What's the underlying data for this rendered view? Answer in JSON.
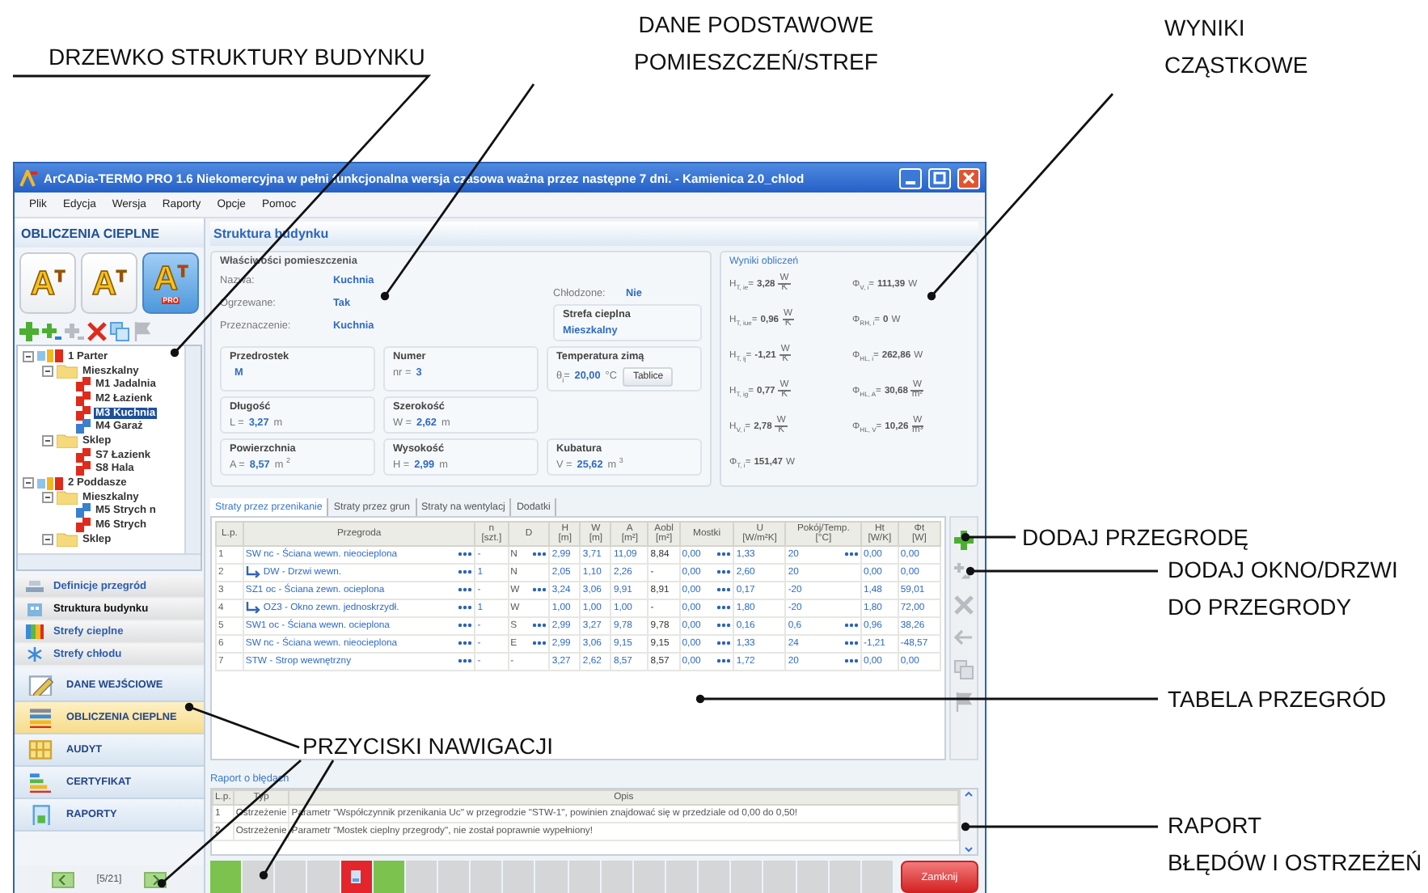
{
  "window": {
    "title": "ArCADia-TERMO PRO 1.6 Niekomercyjna w pełni funkcjonalna wersja czasowa ważna przez następne 7 dni. - Kamienica 2.0_chlod"
  },
  "menu": [
    "Plik",
    "Edycja",
    "Wersja",
    "Raporty",
    "Opcje",
    "Pomoc"
  ],
  "sidebar": {
    "title": "OBLICZENIA CIEPLNE",
    "modes": [
      {
        "letter": "A",
        "superscript": "T",
        "selected": false
      },
      {
        "letter": "A",
        "superscript": "T",
        "selected": false
      },
      {
        "letter": "A",
        "superscript": "T",
        "badge": "PRO",
        "selected": true
      }
    ],
    "tools": [
      {
        "kind": "add",
        "disabled": false
      },
      {
        "kind": "add-small",
        "disabled": false
      },
      {
        "kind": "add-small",
        "disabled": true
      },
      {
        "kind": "delete",
        "disabled": false
      },
      {
        "kind": "copy",
        "disabled": false
      },
      {
        "kind": "flag",
        "disabled": true
      }
    ],
    "tree": [
      {
        "label": "1 Parter",
        "kind": "floor",
        "expanded": true,
        "selected": false,
        "children": [
          {
            "label": "Mieszkalny",
            "kind": "zone",
            "expanded": true,
            "selected": false,
            "children": [
              {
                "label": "M1 Jadalnia",
                "kind": "room",
                "color": "#e02a1c",
                "selected": false
              },
              {
                "label": "M2 Łazienk",
                "kind": "room",
                "color": "#e02a1c",
                "selected": false
              },
              {
                "label": "M3 Kuchnia",
                "kind": "room",
                "color": "#e02a1c",
                "selected": true
              },
              {
                "label": "M4 Garaż",
                "kind": "room",
                "color": "#3a7fd0",
                "selected": false
              }
            ]
          },
          {
            "label": "Sklep",
            "kind": "zone",
            "expanded": true,
            "selected": false,
            "children": [
              {
                "label": "S7 Łazienk",
                "kind": "room",
                "color": "#e02a1c",
                "selected": false
              },
              {
                "label": "S8 Hala",
                "kind": "room",
                "color": "#e02a1c",
                "selected": false
              }
            ]
          }
        ]
      },
      {
        "label": "2 Poddasze",
        "kind": "floor",
        "expanded": true,
        "selected": false,
        "children": [
          {
            "label": "Mieszkalny",
            "kind": "zone",
            "expanded": true,
            "selected": false,
            "children": [
              {
                "label": "M5 Strych n",
                "kind": "room",
                "color": "#3a7fd0",
                "selected": false
              },
              {
                "label": "M6 Strych",
                "kind": "room",
                "color": "#e02a1c",
                "selected": false
              }
            ]
          },
          {
            "label": "Sklep",
            "kind": "zone",
            "expanded": true,
            "selected": false
          }
        ]
      }
    ],
    "sections": [
      {
        "label": "Definicje przegród",
        "kind": "definitions",
        "selected": false
      },
      {
        "label": "Struktura budynku",
        "kind": "structure",
        "selected": true
      },
      {
        "label": "Strefy cieplne",
        "kind": "heat",
        "selected": false
      },
      {
        "label": "Strefy chłodu",
        "kind": "cold",
        "selected": false
      }
    ],
    "nav": [
      {
        "label": "DANE WEJŚCIOWE",
        "kind": "input",
        "selected": false
      },
      {
        "label": "OBLICZENIA CIEPLNE",
        "kind": "calc",
        "selected": true
      },
      {
        "label": "AUDYT",
        "kind": "audit",
        "selected": false
      },
      {
        "label": "CERTYFIKAT",
        "kind": "certificate",
        "selected": false
      },
      {
        "label": "RAPORTY",
        "kind": "report",
        "selected": false
      }
    ],
    "pager": {
      "position": "[5/21]"
    }
  },
  "content": {
    "title": "Struktura budynku",
    "properties": {
      "title": "Właściwości pomieszczenia",
      "fields": [
        {
          "label": "Nazwa:",
          "value": "Kuchnia"
        },
        {
          "label": "Ogrzewane:",
          "value": "Tak"
        },
        {
          "label": "Przeznaczenie:",
          "value": "Kuchnia"
        }
      ],
      "cooling": {
        "label": "Chłodzone:",
        "value": "Nie"
      },
      "zone": {
        "title": "Strefa cieplna",
        "value": "Mieszkalny"
      },
      "group_rows": [
        [
          {
            "title": "Przedrostek",
            "value": "M"
          },
          {
            "title": "Numer",
            "symbol": "nr =",
            "value": "3"
          },
          {
            "title": "Temperatura zimą",
            "symbol": "θ$_{i}$=",
            "value": "20,00",
            "unit": "°C",
            "button": "Tablice"
          }
        ],
        [
          {
            "title": "Długość",
            "symbol": "L =",
            "value": "3,27",
            "unit": "m"
          },
          {
            "title": "Szerokość",
            "symbol": "W =",
            "value": "2,62",
            "unit": "m"
          }
        ],
        [
          {
            "title": "Powierzchnia",
            "symbol": "A =",
            "value": "8,57",
            "unit": "m $^{2}$"
          },
          {
            "title": "Wysokość",
            "symbol": "H =",
            "value": "2,99",
            "unit": "m"
          },
          {
            "title": "Kubatura",
            "symbol": "V =",
            "value": "25,62",
            "unit": "m $^{3}$"
          }
        ]
      ]
    },
    "results": {
      "title": "Wyniki obliczeń",
      "items": [
        {
          "symbol": "H$_{T, ie}$=",
          "value": "3,28",
          "unit": "W",
          "per": "K"
        },
        {
          "symbol": "Φ$_{V, i}$=",
          "value": "111,39",
          "unit": "W"
        },
        {
          "symbol": "H$_{T, iue}$=",
          "value": "0,96",
          "unit": "W",
          "per": "K"
        },
        {
          "symbol": "Φ$_{RH, i}$=",
          "value": "0",
          "unit": "W"
        },
        {
          "symbol": "H$_{T, ij}$=",
          "value": "-1,21",
          "unit": "W",
          "per": "K"
        },
        {
          "symbol": "Φ$_{HL, i}$=",
          "value": "262,86",
          "unit": "W"
        },
        {
          "symbol": "H$_{T, ig}$=",
          "value": "0,77",
          "unit": "W",
          "per": "K"
        },
        {
          "symbol": "Φ$_{HL, A}$=",
          "value": "30,68",
          "unit": "W",
          "per": "m²"
        },
        {
          "symbol": "H$_{V, i}$=",
          "value": "2,78",
          "unit": "W",
          "per": "K"
        },
        {
          "symbol": "Φ$_{HL, V}$=",
          "value": "10,26",
          "unit": "W",
          "per": "m³"
        },
        {
          "symbol": "Φ$_{T, i}$=",
          "value": "151,47",
          "unit": "W"
        }
      ]
    },
    "tabs": [
      {
        "label": "Straty przez przenikanie",
        "selected": true
      },
      {
        "label": "Straty przez grun",
        "selected": false
      },
      {
        "label": "Straty na wentylacj",
        "selected": false
      },
      {
        "label": "Dodatki",
        "selected": false
      }
    ],
    "table": {
      "columns": [
        {
          "name": "L.p."
        },
        {
          "name": "Przegroda"
        },
        {
          "name": "n",
          "unit": "[szt.]"
        },
        {
          "name": "D"
        },
        {
          "name": "H",
          "unit": "[m]"
        },
        {
          "name": "W",
          "unit": "[m]"
        },
        {
          "name": "A",
          "unit": "[m²]"
        },
        {
          "name": "Aobl",
          "unit": "[m²]"
        },
        {
          "name": "Mostki"
        },
        {
          "name": "U",
          "unit": "[W/m²K]"
        },
        {
          "name": "Pokój/Temp.",
          "unit": "[°C]"
        },
        {
          "name": "Ht",
          "unit": "[W/K]"
        },
        {
          "name": "Φt",
          "unit": "[W]"
        }
      ],
      "rows": [
        {
          "kind": "wall",
          "cells": [
            "1",
            "SW nc - Ściana wewn. nieocieplona",
            "-",
            "N",
            "2,99",
            "3,71",
            "11,09",
            "8,84",
            "0,00",
            "1,33",
            "20",
            "0,00",
            "0,00"
          ],
          "pickers": [
            false,
            true,
            false,
            true,
            false,
            false,
            false,
            false,
            true,
            false,
            true,
            false,
            false
          ]
        },
        {
          "kind": "opening",
          "cells": [
            "2",
            "DW - Drzwi wewn.",
            "1",
            "N",
            "2,05",
            "1,10",
            "2,26",
            "-",
            "0,00",
            "2,60",
            "20",
            "0,00",
            "0,00"
          ],
          "pickers": [
            false,
            true,
            false,
            false,
            false,
            false,
            false,
            false,
            true,
            false,
            false,
            false,
            false
          ]
        },
        {
          "kind": "wall",
          "cells": [
            "3",
            "SZ1 oc - Ściana zewn. ocieplona",
            "-",
            "W",
            "3,24",
            "3,06",
            "9,91",
            "8,91",
            "0,00",
            "0,17",
            "-20",
            "1,48",
            "59,01"
          ],
          "pickers": [
            false,
            true,
            false,
            true,
            false,
            false,
            false,
            false,
            true,
            false,
            false,
            false,
            false
          ]
        },
        {
          "kind": "opening",
          "cells": [
            "4",
            "OZ3 - Okno zewn. jednoskrzydł.",
            "1",
            "W",
            "1,00",
            "1,00",
            "1,00",
            "-",
            "0,00",
            "1,80",
            "-20",
            "1,80",
            "72,00"
          ],
          "pickers": [
            false,
            true,
            false,
            false,
            false,
            false,
            false,
            false,
            true,
            false,
            false,
            false,
            false
          ]
        },
        {
          "kind": "wall",
          "cells": [
            "5",
            "SW1 oc - Ściana wewn. ocieplona",
            "-",
            "S",
            "2,99",
            "3,27",
            "9,78",
            "9,78",
            "0,00",
            "0,16",
            "0,6",
            "0,96",
            "38,26"
          ],
          "pickers": [
            false,
            true,
            false,
            true,
            false,
            false,
            false,
            false,
            true,
            false,
            true,
            false,
            false
          ]
        },
        {
          "kind": "wall",
          "cells": [
            "6",
            "SW nc - Ściana wewn. nieocieplona",
            "-",
            "E",
            "2,99",
            "3,06",
            "9,15",
            "9,15",
            "0,00",
            "1,33",
            "24",
            "-1,21",
            "-48,57"
          ],
          "pickers": [
            false,
            true,
            false,
            true,
            false,
            false,
            false,
            false,
            true,
            false,
            true,
            false,
            false
          ]
        },
        {
          "kind": "wall",
          "cells": [
            "7",
            "STW - Strop wewnętrzny",
            "-",
            "-",
            "3,27",
            "2,62",
            "8,57",
            "8,57",
            "0,00",
            "1,72",
            "20",
            "0,00",
            "0,00"
          ],
          "pickers": [
            false,
            true,
            false,
            false,
            false,
            false,
            false,
            false,
            true,
            false,
            true,
            false,
            false
          ]
        }
      ]
    },
    "tools": [
      {
        "kind": "add",
        "disabled": false
      },
      {
        "kind": "add-opening",
        "disabled": true
      },
      {
        "kind": "delete",
        "disabled": true
      },
      {
        "kind": "back",
        "disabled": true
      },
      {
        "kind": "copy",
        "disabled": true
      },
      {
        "kind": "flag",
        "disabled": true
      }
    ],
    "report": {
      "title": "Raport o błędach",
      "columns": [
        "L.p.",
        "Typ",
        "Opis"
      ],
      "rows": [
        [
          "1",
          "Ostrzeżenie",
          "Parametr \"Współczynnik przenikania Uc\" w przegrodzie \"STW-1\", powinien znajdować się w przedziale od 0,00 do 0,50!"
        ],
        [
          "2",
          "Ostrzeżenie",
          "Parametr \"Mostek cieplny przegrody\", nie został poprawnie wypełniony!"
        ]
      ]
    }
  },
  "status_segments": [
    {
      "color": "#7cc24e",
      "selected": false
    },
    {
      "color": "#d4d6d8",
      "selected": false
    },
    {
      "color": "#d4d6d8",
      "selected": false
    },
    {
      "color": "#d4d6d8",
      "selected": false
    },
    {
      "color": "#e3262c",
      "selected": true
    },
    {
      "color": "#7cc24e",
      "selected": false
    },
    {
      "color": "#d4d6d8",
      "selected": false
    },
    {
      "color": "#d4d6d8",
      "selected": false
    },
    {
      "color": "#d4d6d8",
      "selected": false
    },
    {
      "color": "#d4d6d8",
      "selected": false
    },
    {
      "color": "#d4d6d8",
      "selected": false
    },
    {
      "color": "#d4d6d8",
      "selected": false
    },
    {
      "color": "#d4d6d8",
      "selected": false
    },
    {
      "color": "#d4d6d8",
      "selected": false
    },
    {
      "color": "#d4d6d8",
      "selected": false
    },
    {
      "color": "#d4d6d8",
      "selected": false
    },
    {
      "color": "#d4d6d8",
      "selected": false
    },
    {
      "color": "#d4d6d8",
      "selected": false
    },
    {
      "color": "#d4d6d8",
      "selected": false
    },
    {
      "color": "#d4d6d8",
      "selected": false
    },
    {
      "color": "#d4d6d8",
      "selected": false
    }
  ],
  "close_button": "Zamknij",
  "callouts": [
    {
      "lines": [
        "DRZEWKO STRUKTURY BUDYNKU"
      ]
    },
    {
      "lines": [
        "DANE PODSTAWOWE",
        "POMIESZCZEŃ/STREF"
      ]
    },
    {
      "lines": [
        "WYNIKI",
        "CZĄSTKOWE"
      ]
    },
    {
      "lines": [
        "DODAJ PRZEGRODĘ"
      ]
    },
    {
      "lines": [
        "DODAJ OKNO/DRZWI",
        "DO PRZEGRODY"
      ]
    },
    {
      "lines": [
        "TABELA PRZEGRÓD"
      ]
    },
    {
      "lines": [
        "PRZYCISKI NAWIGACJI"
      ]
    },
    {
      "lines": [
        "RAPORT",
        "BŁĘDÓW I OSTRZEŻEŃ"
      ]
    }
  ]
}
